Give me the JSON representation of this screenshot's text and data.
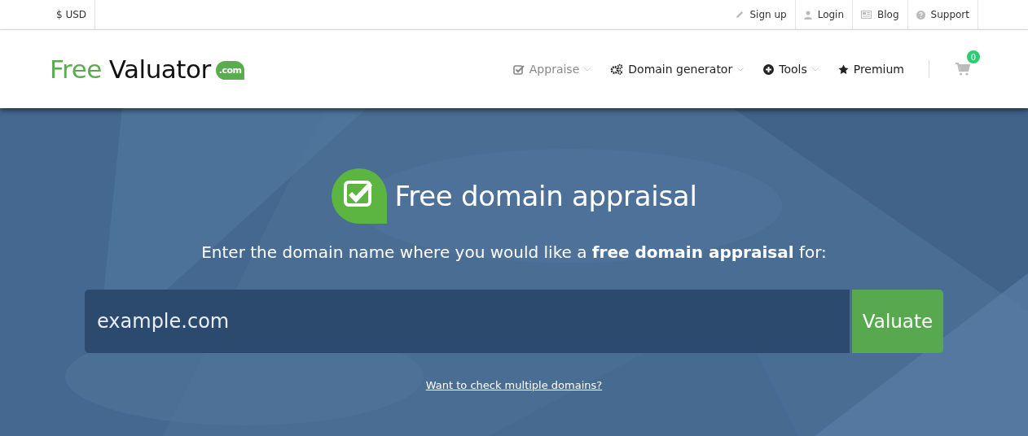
{
  "top_bar": {
    "currency": "$ USD",
    "links": [
      {
        "label": "Sign up"
      },
      {
        "label": "Login"
      },
      {
        "label": "Blog"
      },
      {
        "label": "Support"
      }
    ]
  },
  "header": {
    "logo": {
      "first": "Free",
      "second": "Valuator",
      "badge": ".com"
    },
    "nav": [
      {
        "label": "Appraise",
        "selected": true,
        "dropdown": true
      },
      {
        "label": "Domain generator",
        "selected": false,
        "dropdown": true
      },
      {
        "label": "Tools",
        "selected": false,
        "dropdown": true
      },
      {
        "label": "Premium",
        "selected": false,
        "dropdown": false
      }
    ],
    "cart_count": "0"
  },
  "hero": {
    "title": "Free domain appraisal",
    "subtitle": "Enter the domain name where you would like a **free domain appraisal** for:",
    "domain_field": {
      "placeholder": "example.com"
    },
    "button": "Valuate",
    "link": "Want to check multiple domains?"
  }
}
